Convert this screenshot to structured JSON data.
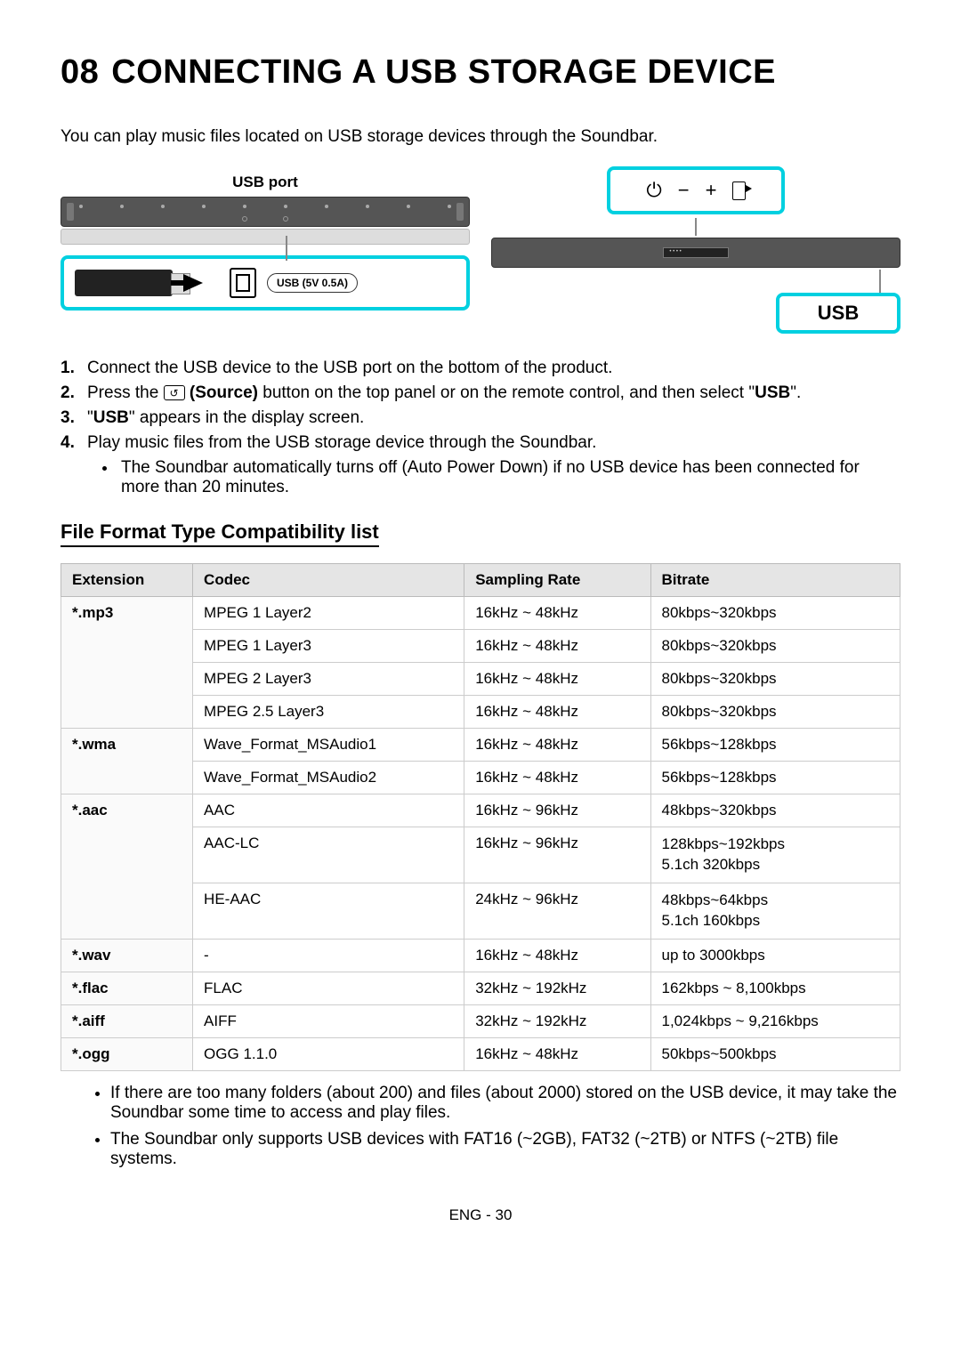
{
  "chapter_num": "08",
  "title": "CONNECTING A USB STORAGE DEVICE",
  "intro": "You can play music files located on USB storage devices through the Soundbar.",
  "diagram": {
    "usb_port_label": "USB port",
    "usb_badge": "USB (5V 0.5A)",
    "top_panel_power": "⏻",
    "top_panel_minus": "−",
    "top_panel_plus": "+",
    "usb_display": "USB"
  },
  "steps": [
    {
      "n": "1.",
      "text_a": "Connect the USB device to the USB port on the bottom of the product."
    },
    {
      "n": "2.",
      "text_a": "Press the ",
      "source_bold": "(Source)",
      "text_b": " button on the top panel or on the remote control, and then select \"",
      "usb_bold": "USB",
      "text_c": "\"."
    },
    {
      "n": "3.",
      "text_a": "\"",
      "usb_bold": "USB",
      "text_b": "\" appears in the display screen."
    },
    {
      "n": "4.",
      "text_a": "Play music files from the USB storage device through the Soundbar."
    }
  ],
  "step4_sub": "The Soundbar automatically turns off (Auto Power Down) if no USB device has been connected for more than 20 minutes.",
  "subhead": "File Format Type Compatibility list",
  "table": {
    "headers": [
      "Extension",
      "Codec",
      "Sampling Rate",
      "Bitrate"
    ],
    "rows": [
      {
        "ext": "*.mp3",
        "codec": "MPEG 1 Layer2",
        "sr": "16kHz ~ 48kHz",
        "br": "80kbps~320kbps",
        "ext_rowspan": 4
      },
      {
        "codec": "MPEG 1 Layer3",
        "sr": "16kHz ~ 48kHz",
        "br": "80kbps~320kbps"
      },
      {
        "codec": "MPEG 2 Layer3",
        "sr": "16kHz ~ 48kHz",
        "br": "80kbps~320kbps"
      },
      {
        "codec": "MPEG 2.5 Layer3",
        "sr": "16kHz ~ 48kHz",
        "br": "80kbps~320kbps"
      },
      {
        "ext": "*.wma",
        "codec": "Wave_Format_MSAudio1",
        "sr": "16kHz ~ 48kHz",
        "br": "56kbps~128kbps",
        "ext_rowspan": 2
      },
      {
        "codec": "Wave_Format_MSAudio2",
        "sr": "16kHz ~ 48kHz",
        "br": "56kbps~128kbps"
      },
      {
        "ext": "*.aac",
        "codec": "AAC",
        "sr": "16kHz ~ 96kHz",
        "br": "48kbps~320kbps",
        "ext_rowspan": 3
      },
      {
        "codec": "AAC-LC",
        "sr": "16kHz ~ 96kHz",
        "br": "128kbps~192kbps\n5.1ch 320kbps"
      },
      {
        "codec": "HE-AAC",
        "sr": "24kHz ~ 96kHz",
        "br": "48kbps~64kbps\n5.1ch 160kbps"
      },
      {
        "ext": "*.wav",
        "codec": "-",
        "sr": "16kHz ~ 48kHz",
        "br": "up to 3000kbps",
        "ext_rowspan": 1
      },
      {
        "ext": "*.flac",
        "codec": "FLAC",
        "sr": "32kHz ~ 192kHz",
        "br": "162kbps ~ 8,100kbps",
        "ext_rowspan": 1
      },
      {
        "ext": "*.aiff",
        "codec": "AIFF",
        "sr": "32kHz ~ 192kHz",
        "br": "1,024kbps ~ 9,216kbps",
        "ext_rowspan": 1
      },
      {
        "ext": "*.ogg",
        "codec": "OGG 1.1.0",
        "sr": "16kHz ~ 48kHz",
        "br": "50kbps~500kbps",
        "ext_rowspan": 1
      }
    ]
  },
  "notes": [
    "If there are too many folders (about 200) and files (about 2000) stored on the USB device, it may take the Soundbar some time to access and play files.",
    "The Soundbar only supports USB devices with FAT16 (~2GB), FAT32 (~2TB) or NTFS (~2TB) file systems."
  ],
  "page_footer": "ENG - 30"
}
